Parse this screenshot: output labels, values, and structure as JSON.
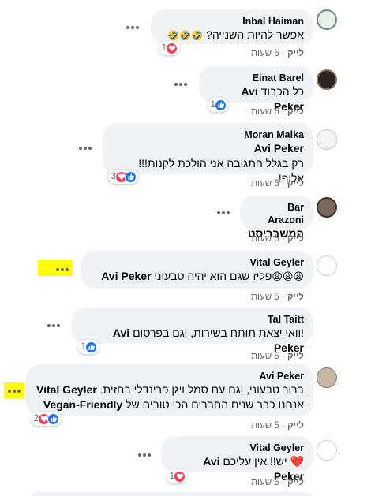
{
  "comments": [
    {
      "author": "Inbal Haiman",
      "text": "אפשר להיות השנייה?",
      "emojis": "🤣🤣🤣",
      "reactions": "1",
      "reaction_types": [
        "love"
      ],
      "like": "לייק",
      "time": "6 שעות"
    },
    {
      "author": "Einat Barel",
      "mention": "Avi Peker",
      "text": "כל הכבוד",
      "reactions": "1",
      "reaction_types": [
        "like"
      ],
      "like": "לייק",
      "time": "6 שעות"
    },
    {
      "author": "Moran Malka",
      "mention": "Avi Peker",
      "text": "רק בגלל התגובה אני הולכת לקנות!!! אלוף!",
      "reactions": "3",
      "reaction_types": [
        "like",
        "love"
      ],
      "like": "לייק",
      "time": "6 שעות"
    },
    {
      "author": "Bar Arazoni",
      "text": "המשבריסט",
      "like": "לייק",
      "time": "5 שעות"
    },
    {
      "author": "Vital Geyler",
      "mention": "Avi Peker",
      "text": "פליז שגם הוא יהיה טבעוני",
      "emojis": "😩😩😩",
      "like": "לייק",
      "time": "5 שעות"
    },
    {
      "author": "Tal Taitt",
      "mention": "Avi Peker",
      "text": "!וואי יצאת תותח בשירות, וגם בפרסום",
      "reactions": "1",
      "reaction_types": [
        "like"
      ],
      "like": "לייק",
      "time": "5 שעות"
    },
    {
      "author": "Avi Peker",
      "mention": "Vital Geyler",
      "line1": "ברור טבעוני, וגם עם סמל ויגן פרינדלי בחזית.",
      "line2": "אנחנו כבר שנים החברים הכי טובים של",
      "line2_bold": "Vegan-Friendly",
      "reactions": "2",
      "reaction_types": [
        "like",
        "love"
      ],
      "like": "לייק",
      "time": "5 שעות"
    },
    {
      "author": "Vital Geyler",
      "mention": "Avi Peker",
      "text": "יש!! אין עליכם",
      "emojis": "❤️",
      "reactions": "1",
      "reaction_types": [
        "love"
      ],
      "like": "לייק",
      "time": "5 שעות"
    }
  ],
  "icons": {
    "more": "more-options-icon",
    "like": "like-reaction-icon",
    "love": "love-reaction-icon"
  },
  "colors": {
    "bubble": "#f0f2f5",
    "like": "#1877f2",
    "love": "#f33e58",
    "highlight": "#ffff00"
  }
}
